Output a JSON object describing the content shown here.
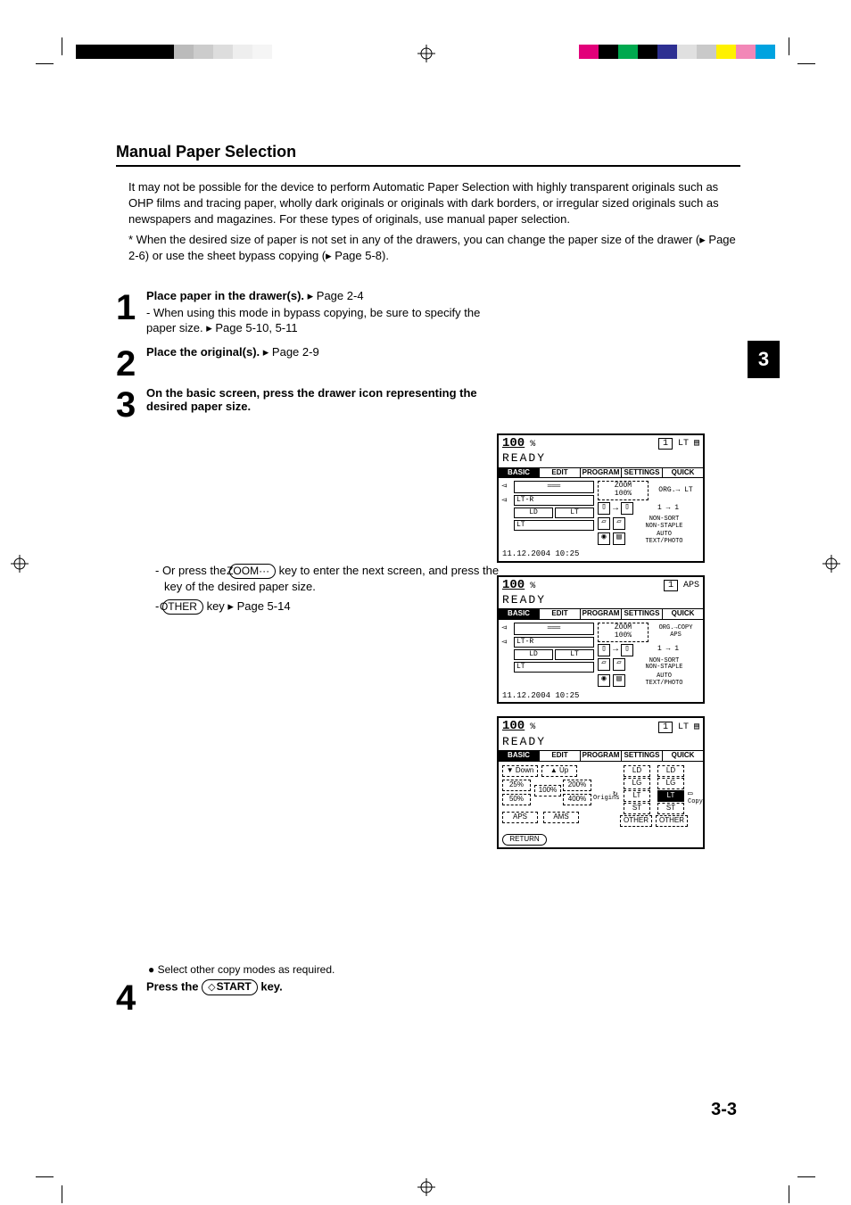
{
  "title": "Manual Paper Selection",
  "intro_p1": "It may not be possible for the device to perform Automatic Paper Selection with highly transparent originals such as OHP films and tracing paper, wholly dark originals or originals with dark borders, or irregular sized originals such as newspapers and magazines. For these types of originals, use manual paper selection.",
  "intro_p2_star": "* When the desired size of paper is not set in any of the drawers, you can change the paper size of the drawer (",
  "intro_p2_mid": " Page 2-6) or use the sheet bypass copying (",
  "intro_p2_end": " Page 5-8).",
  "step1": {
    "title": "Place paper in the drawer(s).",
    "ref": " Page 2-4",
    "sub1": "- When using this mode in bypass copying, be sure to specify the paper size.",
    "sub1ref": " Page 5-10, 5-11"
  },
  "step2": {
    "title": "Place the original(s).",
    "ref": " Page 2-9"
  },
  "step3": {
    "title": "On the basic screen, press the drawer icon representing the desired paper size.",
    "note1_a": "- Or press the ",
    "note1_key": "ZOOM···",
    "note1_b": " key to enter the next screen, and press the key of the desired paper size.",
    "note2_a": "- ",
    "note2_key": "OTHER",
    "note2_b": " key ",
    "note2_ref": " Page 5-14"
  },
  "bullet": "Select other copy modes as required.",
  "step4": {
    "title_a": "Press the ",
    "key": "START",
    "title_b": " key."
  },
  "side_tab": "3",
  "page_num": "3-3",
  "lcd_common": {
    "ratio": "100",
    "pct": "%",
    "count": "1",
    "ready": "READY",
    "tabs": [
      "BASIC",
      "EDIT",
      "PROGRAM",
      "SETTINGS",
      "QUICK"
    ],
    "zoom_label": "ZOOM",
    "zoom_value": "100%",
    "ratio_11": "1 → 1",
    "nonsort": "NON-SORT\nNON-STAPLE",
    "auto_text": "AUTO\nTEXT/PHOTO",
    "timestamp": "11.12.2004 10:25"
  },
  "lcd_a": {
    "paper_label": "LT",
    "org_label": "ORG.→ LT",
    "drawers_row1": "",
    "drawers_r2a": "LT-R",
    "drawers_r3a": "LD",
    "drawers_r3b": "LT",
    "drawers_r4": "LT"
  },
  "lcd_b": {
    "paper_label": "APS",
    "org_label": "ORG.→COPY\nAPS"
  },
  "lcd_c": {
    "paper_label": "LT",
    "down": "▼ Down",
    "up": "▲ Up",
    "p25": "25%",
    "p200": "200%",
    "p100": "100%",
    "p50": "50%",
    "p400": "400%",
    "origins": "Origins",
    "aps": "APS",
    "ams": "AMS",
    "ld": "LD",
    "lg": "LG",
    "lt": "LT",
    "st": "ST",
    "other": "OTHER",
    "copy_lbl": "Copy",
    "return": "RETURN"
  },
  "chips_left": [
    "#000",
    "#000",
    "#000",
    "#000",
    "#000",
    "#bbb",
    "#ccc",
    "#ddd",
    "#eee",
    "#f5f5f5"
  ],
  "chips_right": [
    "#e2007a",
    "#000",
    "#00a94f",
    "#000",
    "#2e3092",
    "#e0e0e0",
    "#c9c9c9",
    "#fff100",
    "#f287b7",
    "#00a3e0"
  ]
}
